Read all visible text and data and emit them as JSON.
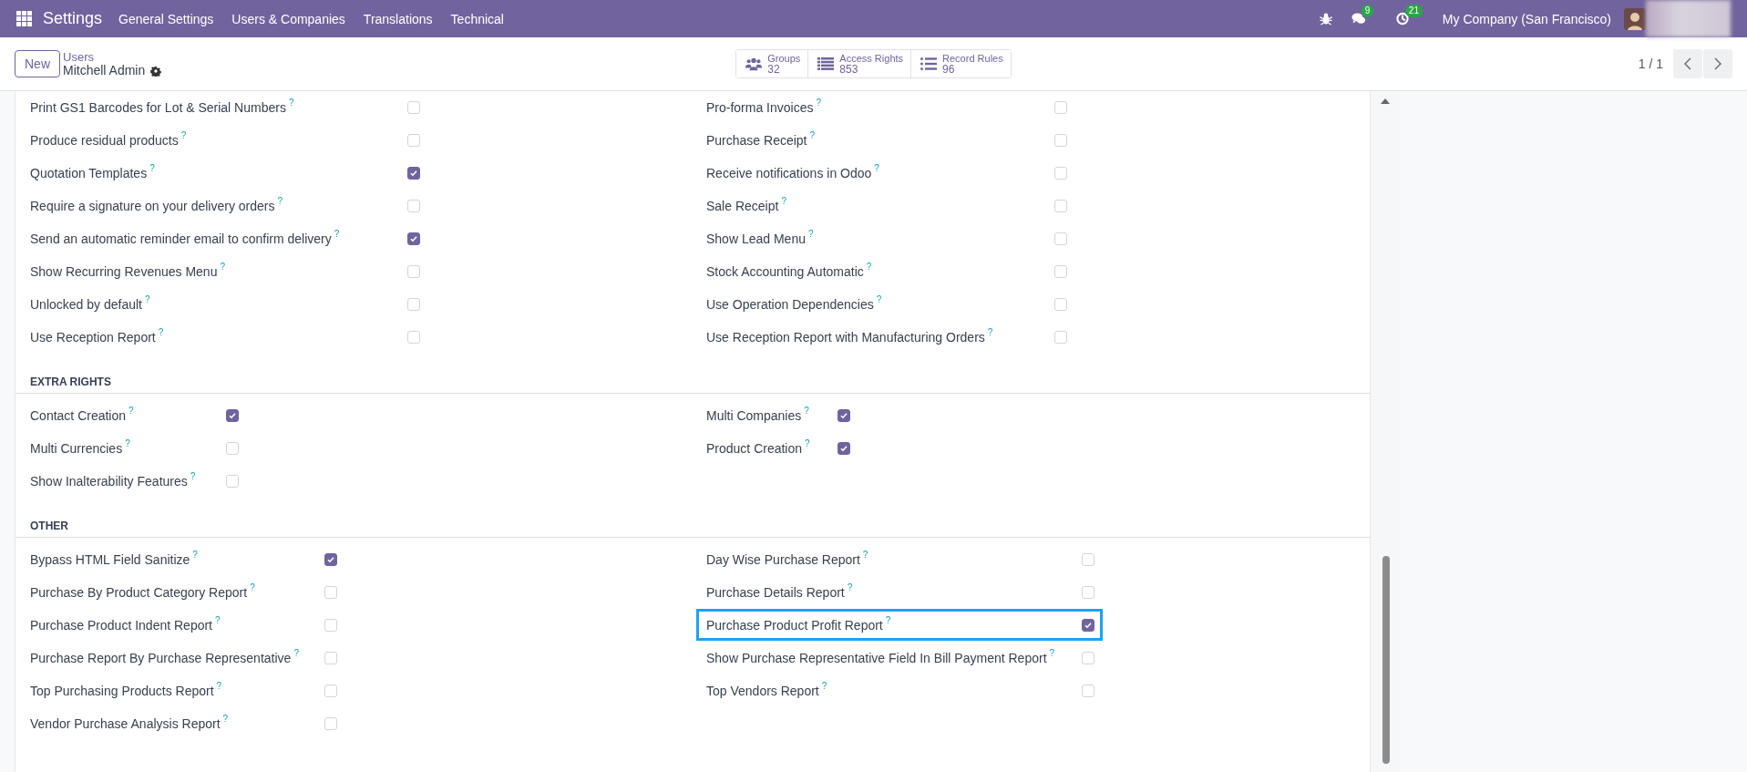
{
  "navbar": {
    "app": "Settings",
    "menu": [
      "General Settings",
      "Users & Companies",
      "Translations",
      "Technical"
    ],
    "chat_badge": "9",
    "activity_badge": "21",
    "company": "My Company (San Francisco)"
  },
  "control_panel": {
    "new_button": "New",
    "breadcrumb": "Users",
    "record": "Mitchell Admin",
    "stats": [
      {
        "kind": "groups",
        "label": "Groups",
        "value": "32"
      },
      {
        "kind": "list",
        "label": "Access Rights",
        "value": "853"
      },
      {
        "kind": "rules",
        "label": "Record Rules",
        "value": "96"
      }
    ],
    "pager": "1 / 1"
  },
  "sections": [
    {
      "columns": [
        [
          {
            "label": "Print GS1 Barcodes for Lot & Serial Numbers",
            "help": "?",
            "checked": false,
            "highlighted": false
          },
          {
            "label": "Produce residual products",
            "help": "?",
            "checked": false,
            "highlighted": false
          },
          {
            "label": "Quotation Templates",
            "help": "?",
            "checked": true,
            "highlighted": false
          },
          {
            "label": "Require a signature on your delivery orders",
            "help": "?",
            "checked": false,
            "highlighted": false
          },
          {
            "label": "Send an automatic reminder email to confirm delivery",
            "help": "?",
            "checked": true,
            "highlighted": false
          },
          {
            "label": "Show Recurring Revenues Menu",
            "help": "?",
            "checked": false,
            "highlighted": false
          },
          {
            "label": "Unlocked by default",
            "help": "?",
            "checked": false,
            "highlighted": false
          },
          {
            "label": "Use Reception Report",
            "help": "?",
            "checked": false,
            "highlighted": false
          }
        ],
        [
          {
            "label": "Pro-forma Invoices",
            "help": "?",
            "checked": false,
            "highlighted": false
          },
          {
            "label": "Purchase Receipt",
            "help": "?",
            "checked": false,
            "highlighted": false
          },
          {
            "label": "Receive notifications in Odoo",
            "help": "?",
            "checked": false,
            "highlighted": false
          },
          {
            "label": "Sale Receipt",
            "help": "?",
            "checked": false,
            "highlighted": false
          },
          {
            "label": "Show Lead Menu",
            "help": "?",
            "checked": false,
            "highlighted": false
          },
          {
            "label": "Stock Accounting Automatic",
            "help": "?",
            "checked": false,
            "highlighted": false
          },
          {
            "label": "Use Operation Dependencies",
            "help": "?",
            "checked": false,
            "highlighted": false
          },
          {
            "label": "Use Reception Report with Manufacturing Orders",
            "help": "?",
            "checked": false,
            "highlighted": false
          }
        ]
      ]
    },
    {
      "title": "EXTRA RIGHTS",
      "columns": [
        [
          {
            "label": "Contact Creation",
            "help": "?",
            "checked": true,
            "highlighted": false
          },
          {
            "label": "Multi Currencies",
            "help": "?",
            "checked": false,
            "highlighted": false
          },
          {
            "label": "Show Inalterability Features",
            "help": "?",
            "checked": false,
            "highlighted": false
          }
        ],
        [
          {
            "label": "Multi Companies",
            "help": "?",
            "checked": true,
            "highlighted": false
          },
          {
            "label": "Product Creation",
            "help": "?",
            "checked": true,
            "highlighted": false
          }
        ]
      ]
    },
    {
      "title": "OTHER",
      "columns": [
        [
          {
            "label": "Bypass HTML Field Sanitize",
            "help": "?",
            "checked": true,
            "highlighted": false
          },
          {
            "label": "Purchase By Product Category Report",
            "help": "?",
            "checked": false,
            "highlighted": false
          },
          {
            "label": "Purchase Product Indent Report",
            "help": "?",
            "checked": false,
            "highlighted": false
          },
          {
            "label": "Purchase Report By Purchase Representative",
            "help": "?",
            "checked": false,
            "highlighted": false
          },
          {
            "label": "Top Purchasing Products Report",
            "help": "?",
            "checked": false,
            "highlighted": false
          },
          {
            "label": "Vendor Purchase Analysis Report",
            "help": "?",
            "checked": false,
            "highlighted": false
          }
        ],
        [
          {
            "label": "Day Wise Purchase Report",
            "help": "?",
            "checked": false,
            "highlighted": false
          },
          {
            "label": "Purchase Details Report",
            "help": "?",
            "checked": false,
            "highlighted": false
          },
          {
            "label": "Purchase Product Profit Report",
            "help": "?",
            "checked": true,
            "highlighted": true
          },
          {
            "label": "Show Purchase Representative Field In Bill Payment Report",
            "help": "?",
            "checked": false,
            "highlighted": false
          },
          {
            "label": "Top Vendors Report",
            "help": "?",
            "checked": false,
            "highlighted": false
          }
        ]
      ]
    }
  ]
}
